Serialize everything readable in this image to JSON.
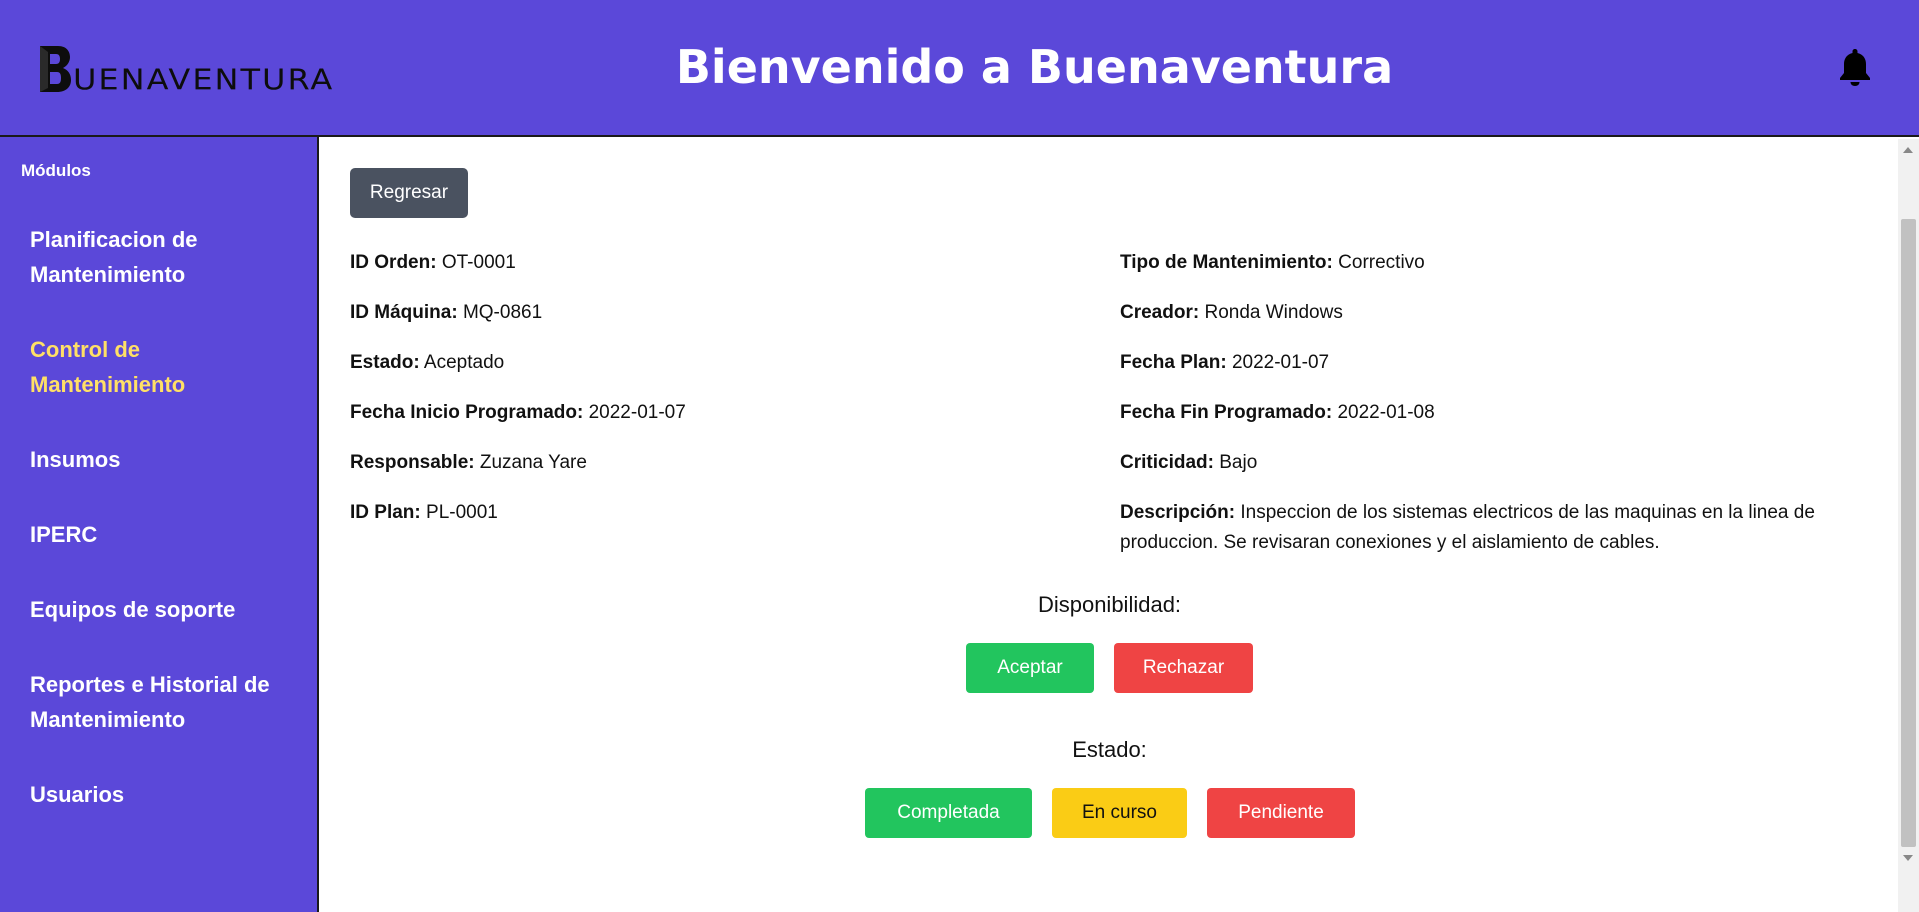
{
  "header": {
    "logo_text": "UENAVENTURA",
    "logo_full": "Buenaventura",
    "title": "Bienvenido a Buenaventura",
    "notification_icon": "bell-icon"
  },
  "sidebar": {
    "heading": "Módulos",
    "items": [
      {
        "label": "Planificacion de Mantenimiento"
      },
      {
        "label": "Control de Mantenimiento",
        "active": true
      },
      {
        "label": "Insumos"
      },
      {
        "label": "IPERC"
      },
      {
        "label": "Equipos de soporte"
      },
      {
        "label": "Reportes e Historial de Mantenimiento"
      },
      {
        "label": "Usuarios"
      }
    ]
  },
  "main": {
    "back_button": "Regresar",
    "fields": {
      "id_orden": {
        "label": "ID Orden:",
        "value": "OT-0001"
      },
      "id_maquina": {
        "label": "ID Máquina:",
        "value": "MQ-0861"
      },
      "estado": {
        "label": "Estado:",
        "value": "Aceptado"
      },
      "fecha_inicio": {
        "label": "Fecha Inicio Programado:",
        "value": "2022-01-07"
      },
      "responsable": {
        "label": "Responsable:",
        "value": "Zuzana Yare"
      },
      "id_plan": {
        "label": "ID Plan:",
        "value": "PL-0001"
      },
      "tipo": {
        "label": "Tipo de Mantenimiento:",
        "value": "Correctivo"
      },
      "creador": {
        "label": "Creador:",
        "value": "Ronda Windows"
      },
      "fecha_plan": {
        "label": "Fecha Plan:",
        "value": "2022-01-07"
      },
      "fecha_fin": {
        "label": "Fecha Fin Programado:",
        "value": "2022-01-08"
      },
      "criticidad": {
        "label": "Criticidad:",
        "value": "Bajo"
      },
      "descripcion": {
        "label": "Descripción:",
        "value": "Inspeccion de los sistemas electricos de las maquinas en la linea de produccion. Se revisaran conexiones y el aislamiento de cables."
      }
    },
    "disponibilidad": {
      "label": "Disponibilidad:",
      "accept": "Aceptar",
      "reject": "Rechazar"
    },
    "estado_section": {
      "label": "Estado:",
      "completed": "Completada",
      "in_progress": "En curso",
      "pending": "Pendiente"
    }
  },
  "colors": {
    "brand": "#5b48d9",
    "active_nav": "#ffe066",
    "back_button": "#4a5260",
    "green": "#22c55e",
    "red": "#ef4444",
    "yellow": "#facc15"
  }
}
